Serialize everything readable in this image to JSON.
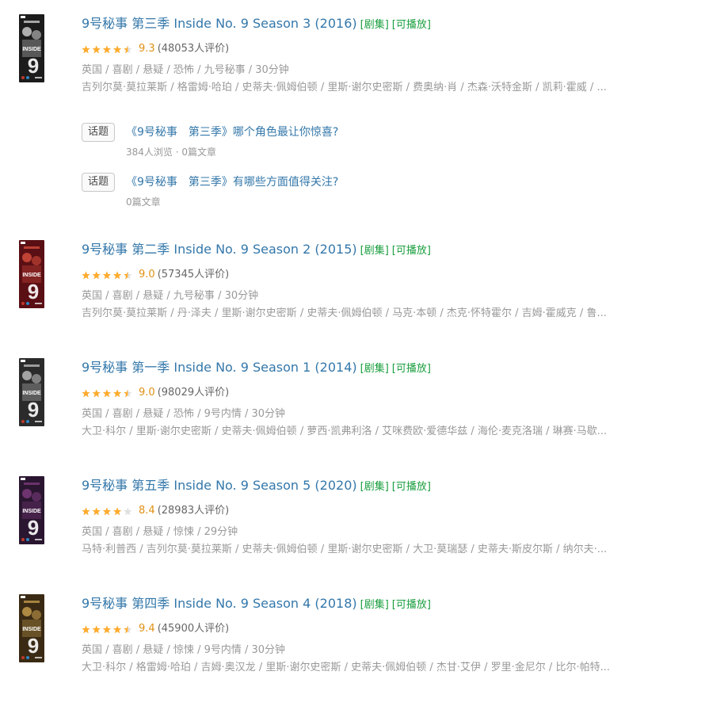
{
  "results": [
    {
      "title": "9号秘事 第三季 Inside No. 9 Season 3 (2016)",
      "tag_series": "[剧集]",
      "tag_playable": "[可播放]",
      "rating_fraction": 0.93,
      "score": "9.3",
      "votes": "(48053人评价)",
      "meta": "英国 / 喜剧 / 悬疑 / 恐怖 / 九号秘事 / 30分钟",
      "cast": "吉列尔莫·莫拉莱斯 / 格雷姆·哈珀 / 史蒂夫·佩姆伯顿 / 里斯·谢尔史密斯 / 费奥纳·肖 / 杰森·沃特金斯 / 凯莉·霍威 / ...",
      "cover_colors": {
        "bg": "#1c1c1c",
        "accent": "#c9c9c9",
        "brand": "#ffffff"
      }
    },
    {
      "title": "9号秘事 第二季 Inside No. 9 Season 2 (2015)",
      "tag_series": "[剧集]",
      "tag_playable": "[可播放]",
      "rating_fraction": 0.9,
      "score": "9.0",
      "votes": "(57345人评价)",
      "meta": "英国 / 喜剧 / 悬疑 / 九号秘事 / 30分钟",
      "cast": "吉列尔莫·莫拉莱斯 / 丹·泽夫 / 里斯·谢尔史密斯 / 史蒂夫·佩姆伯顿 / 马克·本顿 / 杰克·怀特霍尔 / 吉姆·霍威克 / 鲁...",
      "cover_colors": {
        "bg": "#5a0f14",
        "accent": "#d14b3b",
        "brand": "#ffffff"
      }
    },
    {
      "title": "9号秘事 第一季 Inside No. 9 Season 1 (2014)",
      "tag_series": "[剧集]",
      "tag_playable": "[可播放]",
      "rating_fraction": 0.9,
      "score": "9.0",
      "votes": "(98029人评价)",
      "meta": "英国 / 喜剧 / 悬疑 / 恐怖 / 9号内情 / 30分钟",
      "cast": "大卫·科尔 / 里斯·谢尔史密斯 / 史蒂夫·佩姆伯顿 / 萝西·凯弗利洛 / 艾咪费欧·爱德华兹 / 海伦·麦克洛瑞 / 琳赛·马歇...",
      "cover_colors": {
        "bg": "#2b2b2b",
        "accent": "#b9b9b9",
        "brand": "#ffffff"
      }
    },
    {
      "title": "9号秘事 第五季 Inside No. 9 Season 5 (2020)",
      "tag_series": "[剧集]",
      "tag_playable": "[可播放]",
      "rating_fraction": 0.84,
      "score": "8.4",
      "votes": "(28983人评价)",
      "meta": "英国 / 喜剧 / 悬疑 / 惊悚 / 29分钟",
      "cast": "马特·利普西 / 吉列尔莫·莫拉莱斯 / 史蒂夫·佩姆伯顿 / 里斯·谢尔史密斯 / 大卫·莫瑞瑟 / 史蒂夫·斯皮尔斯 / 纳尔夫·...",
      "cover_colors": {
        "bg": "#2a1630",
        "accent": "#7a3a7a",
        "brand": "#ffffff"
      }
    },
    {
      "title": "9号秘事 第四季 Inside No. 9 Season 4 (2018)",
      "tag_series": "[剧集]",
      "tag_playable": "[可播放]",
      "rating_fraction": 0.94,
      "score": "9.4",
      "votes": "(45900人评价)",
      "meta": "英国 / 喜剧 / 悬疑 / 惊悚 / 9号内情 / 30分钟",
      "cast": "大卫·科尔 / 格雷姆·哈珀 / 吉姆·奥汉龙 / 里斯·谢尔史密斯 / 史蒂夫·佩姆伯顿 / 杰甘·艾伊 / 罗里·金尼尔 / 比尔·帕特...",
      "cover_colors": {
        "bg": "#3a2a14",
        "accent": "#c29a4a",
        "brand": "#ffffff"
      }
    }
  ],
  "topics": [
    {
      "badge": "话题",
      "title": "《9号秘事　第三季》哪个角色最让你惊喜?",
      "stats": "384人浏览 · 0篇文章"
    },
    {
      "badge": "话题",
      "title": "《9号秘事　第三季》有哪些方面值得关注?",
      "stats": "0篇文章"
    }
  ],
  "colors": {
    "star_fill": "#ffac2d",
    "star_empty": "#e0e0e0",
    "link": "#3377aa",
    "tag": "#1a9e3f"
  }
}
